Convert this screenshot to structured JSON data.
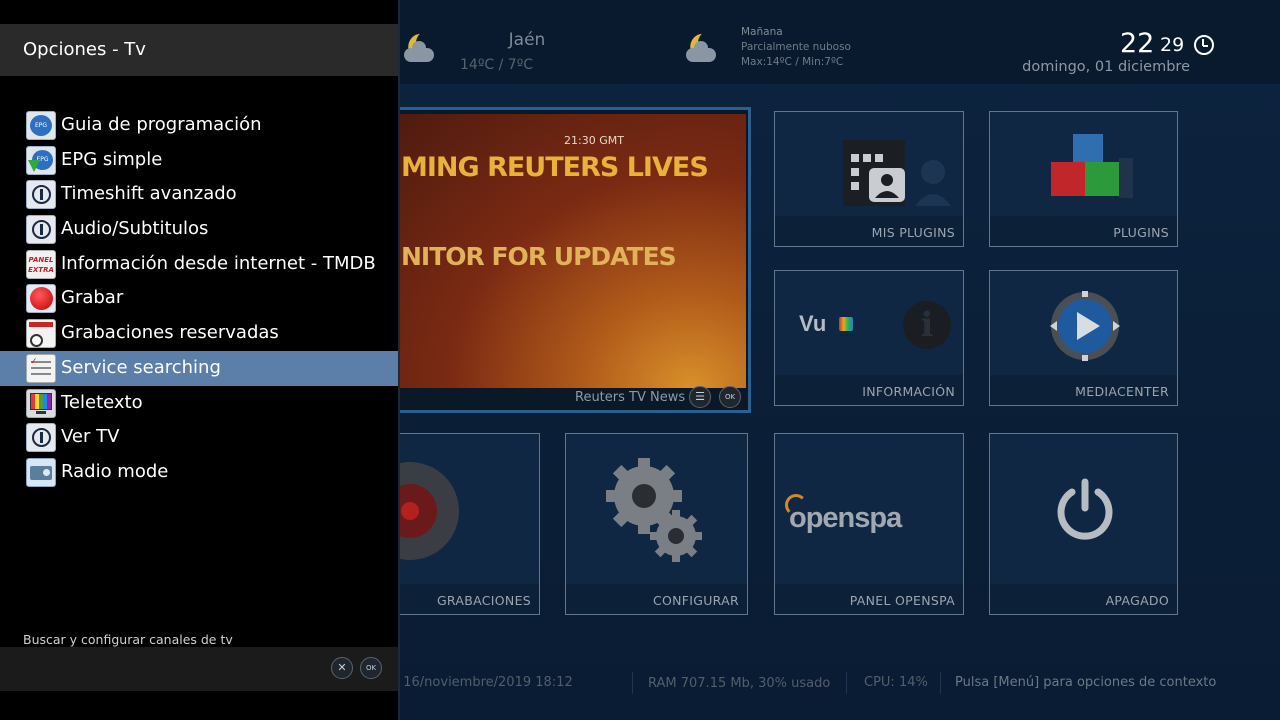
{
  "weather": {
    "city": "Jaén",
    "temps": "14ºC / 7ºC",
    "tomorrow_label": "Mañana",
    "tomorrow_desc": "Parcialmente nuboso",
    "tomorrow_range": "Max:14ºC / Min:7ºC",
    "icon": "moon-cloud-icon"
  },
  "clock": {
    "hours": "22",
    "minutes": "29",
    "date": "domingo, 01 diciembre"
  },
  "video": {
    "timestamp": "21:30  GMT",
    "headline1": "MING REUTERS LIVES",
    "headline2": "NITOR FOR UPDATES",
    "channel": "Reuters TV News",
    "menu_btn": "☰",
    "ok_btn": "OK"
  },
  "tiles": [
    {
      "id": "mis-plugins",
      "label": "MIS PLUGINS"
    },
    {
      "id": "plugins",
      "label": "PLUGINS"
    },
    {
      "id": "informacion",
      "label": "INFORMACIÓN"
    },
    {
      "id": "mediacenter",
      "label": "MEDIACENTER"
    },
    {
      "id": "grabaciones",
      "label": "GRABACIONES"
    },
    {
      "id": "configurar",
      "label": "CONFIGURAR"
    },
    {
      "id": "panel-openspa",
      "label": "PANEL OPENSPA"
    },
    {
      "id": "apagado",
      "label": "APAGADO"
    }
  ],
  "info_logo": "Vu",
  "openspa_logo": "openspa",
  "statusbar": {
    "date": ", 16/noviembre/2019 18:12",
    "ram": "RAM 707.15 Mb, 30% usado",
    "cpu": "CPU:  14%",
    "hint": "Pulsa [Menú] para opciones de contexto"
  },
  "panel": {
    "title": "Opciones - Tv",
    "selected_index": 7,
    "items": [
      {
        "label": "Guia de programación",
        "icon": "epg-icon"
      },
      {
        "label": "EPG simple",
        "icon": "epg-download-icon"
      },
      {
        "label": "Timeshift avanzado",
        "icon": "plug-icon"
      },
      {
        "label": "Audio/Subtitulos",
        "icon": "plug-icon"
      },
      {
        "label": "Información desde internet - TMDB",
        "icon": "panel-extra-icon"
      },
      {
        "label": "Grabar",
        "icon": "record-icon"
      },
      {
        "label": "Grabaciones reservadas",
        "icon": "calendar-clock-icon"
      },
      {
        "label": "Service searching",
        "icon": "checklist-icon"
      },
      {
        "label": "Teletexto",
        "icon": "tv-icon"
      },
      {
        "label": "Ver TV",
        "icon": "plug-icon"
      },
      {
        "label": "Radio mode",
        "icon": "radio-icon"
      }
    ],
    "icon_text": {
      "epg": "EPG",
      "panel_extra_1": "PANEL",
      "panel_extra_2": "EXTRA"
    },
    "hint": "Buscar y configurar canales de tv",
    "close_btn": "✕",
    "ok_btn": "OK"
  },
  "colors": {
    "selection": "#5b7fa8",
    "panel_bg": "#000000",
    "title_bar": "#2a2a2a",
    "tile_border": "#5f7790",
    "video_border": "#2b5f8f"
  }
}
